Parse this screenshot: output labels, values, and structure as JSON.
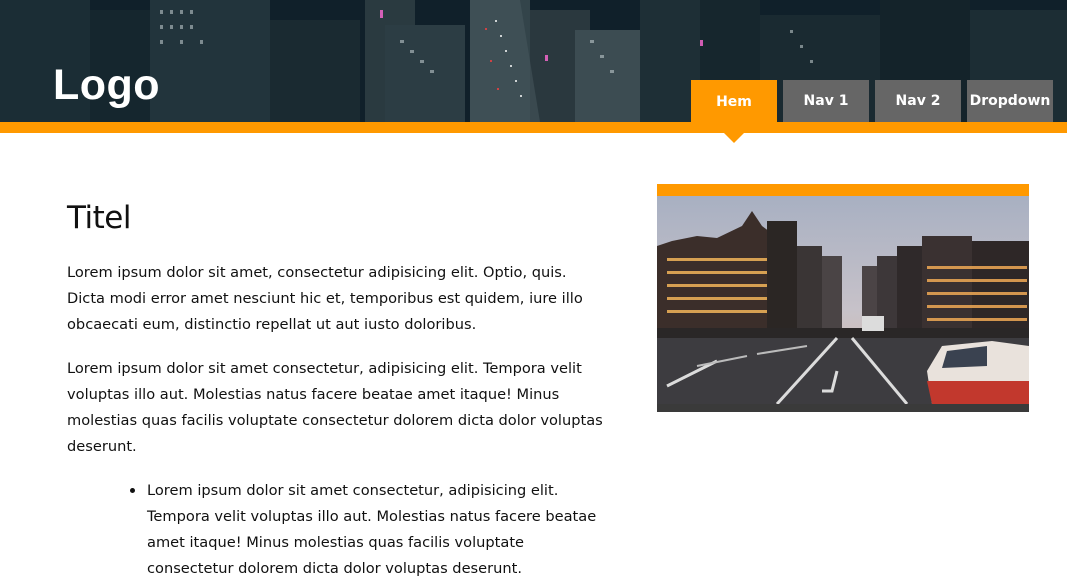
{
  "header": {
    "logo": "Logo",
    "nav": [
      {
        "label": "Hem",
        "active": true
      },
      {
        "label": "Nav 1",
        "active": false
      },
      {
        "label": "Nav 2",
        "active": false
      },
      {
        "label": "Dropdown",
        "active": false
      }
    ]
  },
  "main": {
    "title": "Titel",
    "paragraphs": [
      "Lorem ipsum dolor sit amet, consectetur adipisicing elit. Optio, quis. Dicta modi error amet nesciunt hic et, temporibus est quidem, iure illo obcaecati eum, distinctio repellat ut aut iusto doloribus.",
      "Lorem ipsum dolor sit amet consectetur, adipisicing elit. Tempora velit voluptas illo aut. Molestias natus facere beatae amet itaque! Minus molestias quas facilis voluptate consectetur dolorem dicta dolor voluptas deserunt."
    ],
    "list": [
      "Lorem ipsum dolor sit amet consectetur, adipisicing elit. Tempora velit voluptas illo aut. Molestias natus facere beatae amet itaque! Minus molestias quas facilis voluptate consectetur dolorem dicta dolor voluptas deserunt."
    ]
  },
  "colors": {
    "accent": "#ff9900",
    "nav_inactive": "#666666",
    "header_bg": "#12242b"
  }
}
